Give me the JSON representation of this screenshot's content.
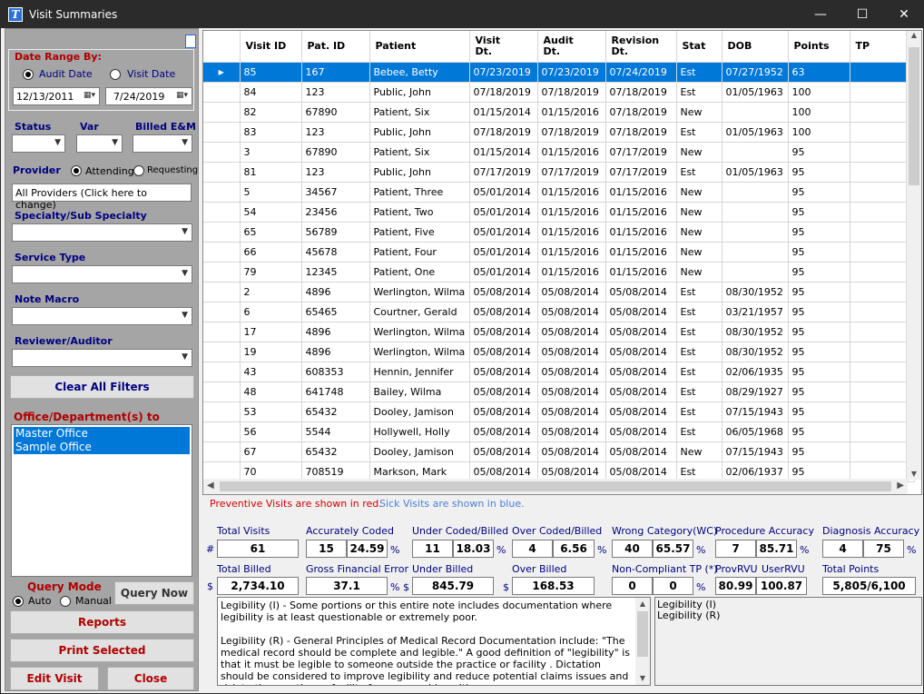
{
  "window": {
    "title": "Visit Summaries",
    "minimize": "—",
    "maximize": "☐",
    "close": "✕"
  },
  "sidebar": {
    "date_range_label": "Date Range By:",
    "audit_date": "Audit Date",
    "visit_date": "Visit Date",
    "date_from": "12/13/2011",
    "date_to": "7/24/2019",
    "status": "Status",
    "var": "Var",
    "billed_em": "Billed E&M",
    "provider": "Provider",
    "attending": "Attending",
    "requesting": "Requesting",
    "provider_value": "All Providers (Click here to change)",
    "specialty": "Specialty/Sub Specialty",
    "service_type": "Service Type",
    "note_macro": "Note Macro",
    "reviewer": "Reviewer/Auditor",
    "clear_filters": "Clear All Filters",
    "office_label": "Office/Department(s) to query",
    "offices": [
      "Master Office",
      "Sample Office"
    ],
    "query_mode": "Query Mode",
    "auto": "Auto",
    "manual": "Manual",
    "query_now": "Query Now",
    "reports": "Reports",
    "print_selected": "Print Selected",
    "edit_visit": "Edit Visit",
    "close": "Close"
  },
  "grid": {
    "columns": [
      "Visit ID",
      "Pat. ID",
      "Patient",
      "Visit\nDt.",
      "Audit\nDt.",
      "Revision\nDt.",
      "Stat",
      "DOB",
      "Points",
      "TP"
    ],
    "rows": [
      [
        "85",
        "167",
        "Bebee, Betty",
        "07/23/2019",
        "07/23/2019",
        "07/24/2019",
        "Est",
        "07/27/1952",
        "63",
        ""
      ],
      [
        "84",
        "123",
        "Public, John",
        "07/18/2019",
        "07/18/2019",
        "07/18/2019",
        "Est",
        "01/05/1963",
        "100",
        ""
      ],
      [
        "82",
        "67890",
        "Patient, Six",
        "01/15/2014",
        "01/15/2016",
        "07/18/2019",
        "New",
        "",
        "100",
        ""
      ],
      [
        "83",
        "123",
        "Public, John",
        "07/18/2019",
        "07/18/2019",
        "07/18/2019",
        "Est",
        "01/05/1963",
        "100",
        ""
      ],
      [
        "3",
        "67890",
        "Patient, Six",
        "01/15/2014",
        "01/15/2016",
        "07/17/2019",
        "New",
        "",
        "95",
        ""
      ],
      [
        "81",
        "123",
        "Public, John",
        "07/17/2019",
        "07/17/2019",
        "07/17/2019",
        "Est",
        "01/05/1963",
        "95",
        ""
      ],
      [
        "5",
        "34567",
        "Patient, Three",
        "05/01/2014",
        "01/15/2016",
        "01/15/2016",
        "New",
        "",
        "95",
        ""
      ],
      [
        "54",
        "23456",
        "Patient, Two",
        "05/01/2014",
        "01/15/2016",
        "01/15/2016",
        "New",
        "",
        "95",
        ""
      ],
      [
        "65",
        "56789",
        "Patient, Five",
        "05/01/2014",
        "01/15/2016",
        "01/15/2016",
        "New",
        "",
        "95",
        ""
      ],
      [
        "66",
        "45678",
        "Patient, Four",
        "05/01/2014",
        "01/15/2016",
        "01/15/2016",
        "New",
        "",
        "95",
        ""
      ],
      [
        "79",
        "12345",
        "Patient, One",
        "05/01/2014",
        "01/15/2016",
        "01/15/2016",
        "New",
        "",
        "95",
        ""
      ],
      [
        "2",
        "4896",
        "Werlington, Wilma",
        "05/08/2014",
        "05/08/2014",
        "05/08/2014",
        "Est",
        "08/30/1952",
        "95",
        ""
      ],
      [
        "6",
        "65465",
        "Courtner, Gerald",
        "05/08/2014",
        "05/08/2014",
        "05/08/2014",
        "Est",
        "03/21/1957",
        "95",
        ""
      ],
      [
        "17",
        "4896",
        "Werlington, Wilma",
        "05/08/2014",
        "05/08/2014",
        "05/08/2014",
        "Est",
        "08/30/1952",
        "95",
        ""
      ],
      [
        "19",
        "4896",
        "Werlington, Wilma",
        "05/08/2014",
        "05/08/2014",
        "05/08/2014",
        "Est",
        "08/30/1952",
        "95",
        ""
      ],
      [
        "43",
        "608353",
        "Hennin, Jennifer",
        "05/08/2014",
        "05/08/2014",
        "05/08/2014",
        "Est",
        "02/06/1935",
        "95",
        ""
      ],
      [
        "48",
        "641748",
        "Bailey, Wilma",
        "05/08/2014",
        "05/08/2014",
        "05/08/2014",
        "Est",
        "08/29/1927",
        "95",
        ""
      ],
      [
        "53",
        "65432",
        "Dooley, Jamison",
        "05/08/2014",
        "05/08/2014",
        "05/08/2014",
        "Est",
        "07/15/1943",
        "95",
        ""
      ],
      [
        "56",
        "5544",
        "Hollywell, Holly",
        "05/08/2014",
        "05/08/2014",
        "05/08/2014",
        "Est",
        "06/05/1968",
        "95",
        ""
      ],
      [
        "67",
        "65432",
        "Dooley, Jamison",
        "05/08/2014",
        "05/08/2014",
        "05/08/2014",
        "New",
        "07/15/1943",
        "95",
        ""
      ],
      [
        "70",
        "708519",
        "Markson, Mark",
        "05/08/2014",
        "05/08/2014",
        "05/08/2014",
        "Est",
        "02/06/1937",
        "95",
        ""
      ]
    ]
  },
  "legend": {
    "preventive": "Preventive Visits are shown in red.",
    "sick": "Sick Visits are shown in blue."
  },
  "stats": {
    "hash": "#",
    "dollar": "$",
    "pct": "%",
    "total_visits": {
      "label": "Total Visits",
      "value": "61"
    },
    "accurately_coded": {
      "label": "Accurately Coded",
      "n": "15",
      "p": "24.59"
    },
    "under_coded": {
      "label": "Under Coded/Billed",
      "n": "11",
      "p": "18.03"
    },
    "over_coded": {
      "label": "Over Coded/Billed",
      "n": "4",
      "p": "6.56"
    },
    "wrong_category": {
      "label": "Wrong Category(WC)",
      "n": "40",
      "p": "65.57"
    },
    "procedure_accuracy": {
      "label": "Procedure Accuracy",
      "n": "7",
      "p": "85.71"
    },
    "diagnosis_accuracy": {
      "label": "Diagnosis Accuracy",
      "n": "4",
      "p": "75"
    },
    "total_billed": {
      "label": "Total Billed",
      "value": "2,734.10"
    },
    "gross_error": {
      "label": "Gross Financial Error",
      "value": "37.1"
    },
    "under_billed": {
      "label": "Under Billed",
      "value": "845.79"
    },
    "over_billed": {
      "label": "Over Billed",
      "value": "168.53"
    },
    "non_compliant": {
      "label": "Non-Compliant TP (*)",
      "n": "0",
      "p": "0"
    },
    "prov_rvu": {
      "label": "ProvRVU",
      "value": "80.99"
    },
    "user_rvu": {
      "label": "UserRVU",
      "value": "100.87"
    },
    "total_points": {
      "label": "Total Points",
      "value": "5,805/6,100"
    }
  },
  "notes": {
    "p1": "Legibility (I) - Some portions or this entire note includes documentation where legibility is at least questionable or extremely poor.",
    "p2": "Legibility (R) - General Principles of Medical Record Documentation include: \"The medical record should be complete and legible.\"  A good definition of \"legibility\" is that it must be legible to someone outside the practice or facility .  Dictation should be considered to improve legibility and reduce potential claims issues and risk to the practice or facility for any provider with poor",
    "codes": [
      "Legibility (I)",
      "Legibility (R)"
    ]
  }
}
